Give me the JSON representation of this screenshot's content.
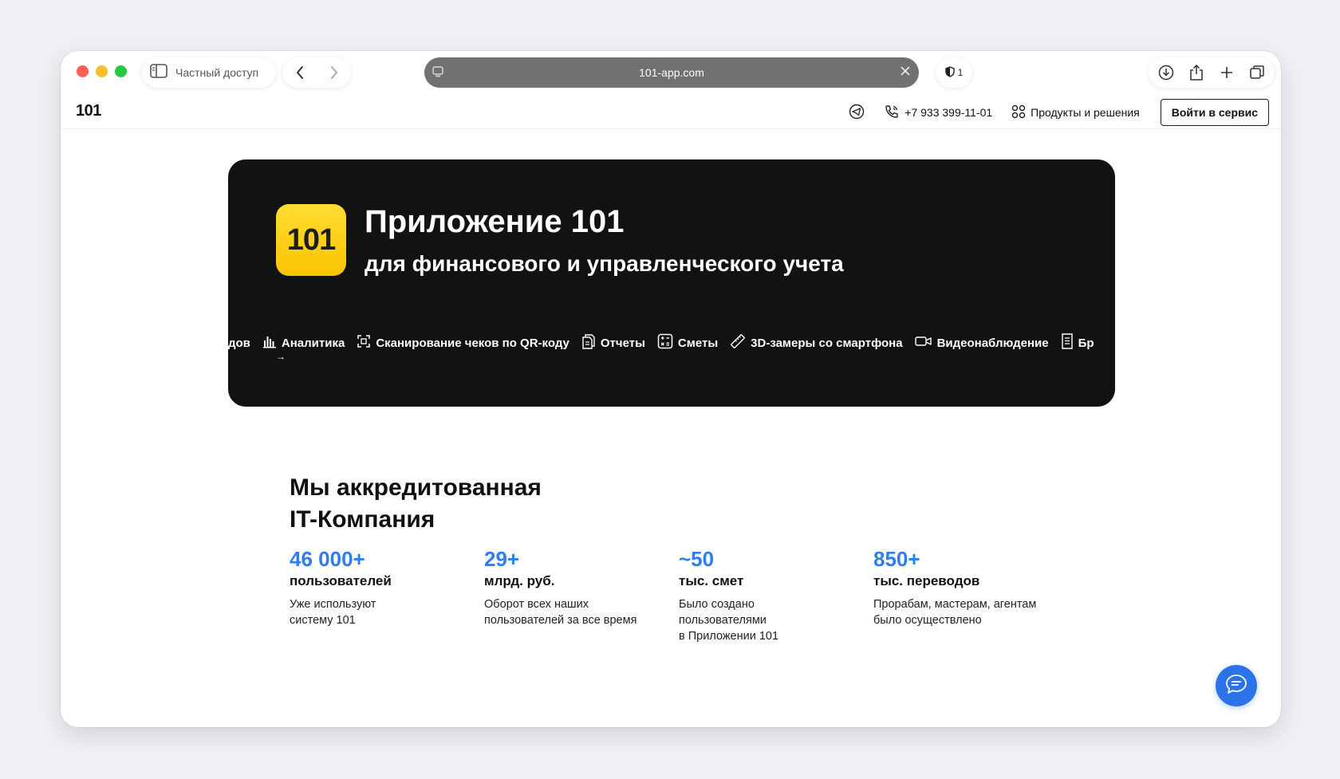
{
  "browser": {
    "private_label": "Частный доступ",
    "url": "101-app.com",
    "tracker_count": "1"
  },
  "header": {
    "logo": "101",
    "phone": "+7 933 399-11-01",
    "products": "Продукты и решения",
    "login": "Войти в сервис"
  },
  "hero": {
    "icon_text": "101",
    "title": "Приложение 101",
    "subtitle": "для финансового и управленческого учета",
    "features": [
      {
        "label": "дов",
        "icon": "none"
      },
      {
        "label": "Аналитика",
        "icon": "bar-chart-icon"
      },
      {
        "label": "Сканирование чеков по QR-коду",
        "icon": "qr-scan-icon"
      },
      {
        "label": "Отчеты",
        "icon": "documents-icon"
      },
      {
        "label": "Сметы",
        "icon": "calculator-icon"
      },
      {
        "label": "3D-замеры со смартфона",
        "icon": "ruler-icon"
      },
      {
        "label": "Видеонаблюдение",
        "icon": "video-camera-icon"
      },
      {
        "label": "Бр",
        "icon": "document-list-icon"
      }
    ]
  },
  "company": {
    "title_line1": "Мы аккредитованная",
    "title_line2": "IT-Компания",
    "stats": [
      {
        "num": "46 000+",
        "unit": "пользователей",
        "desc": "Уже используют\nсистему 101"
      },
      {
        "num": "29+",
        "unit": "млрд. руб.",
        "desc": "Оборот всех наших\nпользователей за все время"
      },
      {
        "num": "~50",
        "unit": "тыс. смет",
        "desc": "Было создано\nпользователями\nв Приложении 101"
      },
      {
        "num": "850+",
        "unit": "тыс. переводов",
        "desc": "Прорабам, мастерам, агентам\nбыло осуществлено"
      }
    ]
  },
  "colors": {
    "accent_blue": "#2f7df2",
    "hero_bg": "#121212",
    "app_icon_yellow": "#ffd21f",
    "chat_button": "#2c72e8"
  }
}
